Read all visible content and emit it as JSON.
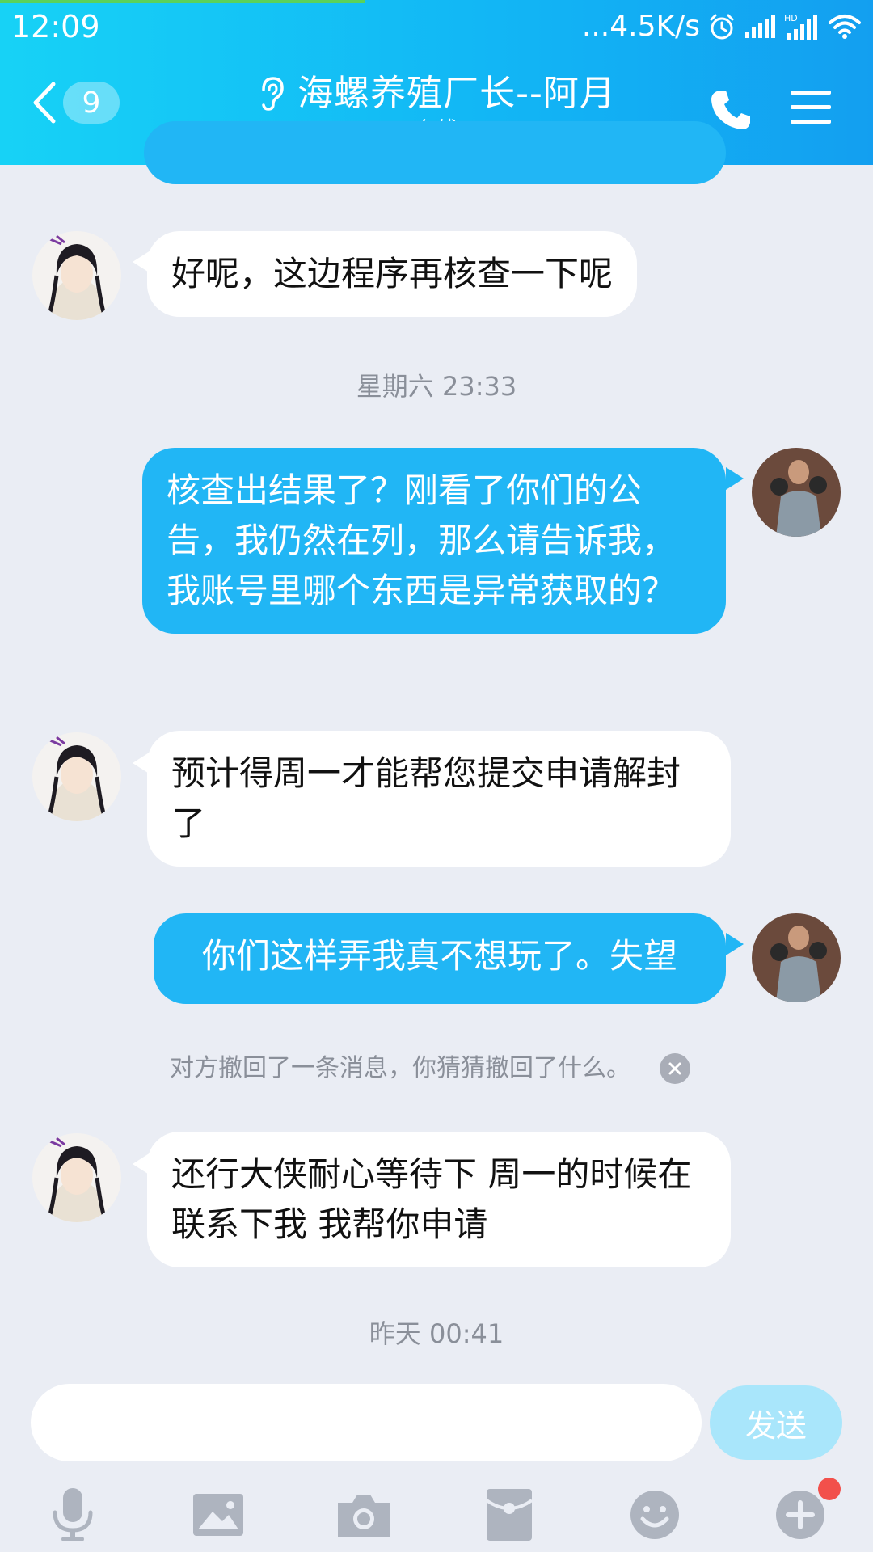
{
  "status_bar": {
    "time": "12:09",
    "net_speed": "...4.5K/s"
  },
  "header": {
    "unread_count": "9",
    "title": "海螺养殖厂长--阿月",
    "subtitle": "在线"
  },
  "messages": [
    {
      "side": "in",
      "text": "好呢，这边程序再核查一下呢"
    },
    {
      "side": "out",
      "text": "核查出结果了？刚看了你们的公告，我仍然在列，那么请告诉我，我账号里哪个东西是异常获取的？"
    },
    {
      "side": "in",
      "text": "预计得周一才能帮您提交申请解封了"
    },
    {
      "side": "out",
      "text": "你们这样弄我真不想玩了。失望"
    },
    {
      "side": "in",
      "text": "还行大侠耐心等待下 周一的时候在联系下我 我帮你申请"
    }
  ],
  "timestamps": [
    "星期六 23:33",
    "昨天 00:41"
  ],
  "recall_notice": "对方撤回了一条消息，你猜猜撤回了什么。",
  "input": {
    "value": "",
    "send_label": "发送"
  },
  "toolbar_icons": [
    "microphone-icon",
    "image-icon",
    "camera-icon",
    "red-packet-icon",
    "emoji-icon",
    "plus-icon"
  ],
  "colors": {
    "header_gradient_start": "#17d2f6",
    "header_gradient_end": "#139ff0",
    "outgoing_bubble": "#21b6f5",
    "incoming_bubble": "#ffffff",
    "background": "#eaedf4",
    "send_button": "#a9e6fb",
    "notification_dot": "#f2504b"
  }
}
